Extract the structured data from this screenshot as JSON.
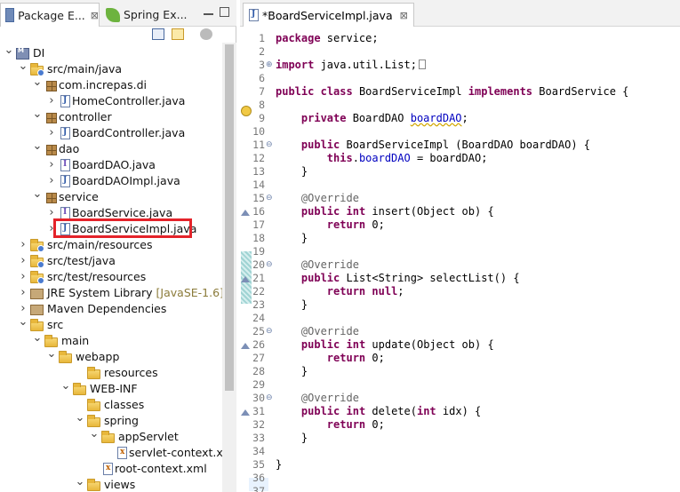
{
  "left_panel": {
    "tabs": [
      {
        "label": "Package E...",
        "close": "⊠",
        "active": true
      },
      {
        "label": "Spring Ex...",
        "close": "⊠",
        "active": false
      }
    ],
    "tree": [
      {
        "label": "DI",
        "icon": "project-icon",
        "arrow": "down"
      },
      {
        "label": "src/main/java",
        "icon": "source-folder-icon",
        "arrow": "down"
      },
      {
        "label": "com.increpas.di",
        "icon": "package-icon",
        "arrow": "down"
      },
      {
        "label": "HomeController.java",
        "icon": "java-file-icon",
        "arrow": "right"
      },
      {
        "label": "controller",
        "icon": "package-icon",
        "arrow": "down"
      },
      {
        "label": "BoardController.java",
        "icon": "java-file-icon",
        "arrow": "right"
      },
      {
        "label": "dao",
        "icon": "package-icon",
        "arrow": "down"
      },
      {
        "label": "BoardDAO.java",
        "icon": "java-interface-icon",
        "arrow": "right"
      },
      {
        "label": "BoardDAOImpl.java",
        "icon": "java-file-icon",
        "arrow": "right"
      },
      {
        "label": "service",
        "icon": "package-icon",
        "arrow": "down"
      },
      {
        "label": "BoardService.java",
        "icon": "java-interface-icon",
        "arrow": "right"
      },
      {
        "label": "BoardServiceImpl.java",
        "icon": "java-file-icon",
        "arrow": "right",
        "highlighted": true
      },
      {
        "label": "src/main/resources",
        "icon": "source-folder-icon",
        "arrow": "right"
      },
      {
        "label": "src/test/java",
        "icon": "source-folder-icon",
        "arrow": "right"
      },
      {
        "label": "src/test/resources",
        "icon": "source-folder-icon",
        "arrow": "right"
      },
      {
        "label": "JRE System Library",
        "decoration": "[JavaSE-1.6]",
        "icon": "library-icon",
        "arrow": "right"
      },
      {
        "label": "Maven Dependencies",
        "icon": "library-icon",
        "arrow": "right"
      },
      {
        "label": "src",
        "icon": "folder-icon",
        "arrow": "down"
      },
      {
        "label": "main",
        "icon": "folder-icon",
        "arrow": "down"
      },
      {
        "label": "webapp",
        "icon": "folder-icon",
        "arrow": "down"
      },
      {
        "label": "resources",
        "icon": "folder-icon",
        "arrow": "none"
      },
      {
        "label": "WEB-INF",
        "icon": "folder-icon",
        "arrow": "down"
      },
      {
        "label": "classes",
        "icon": "folder-icon",
        "arrow": "none"
      },
      {
        "label": "spring",
        "icon": "folder-icon",
        "arrow": "down"
      },
      {
        "label": "appServlet",
        "icon": "folder-icon",
        "arrow": "down"
      },
      {
        "label": "servlet-context.xml",
        "icon": "xml-file-icon",
        "arrow": "none"
      },
      {
        "label": "root-context.xml",
        "icon": "xml-file-icon",
        "arrow": "none"
      },
      {
        "label": "views",
        "icon": "folder-icon",
        "arrow": "down"
      }
    ]
  },
  "editor": {
    "tab_label": "*BoardServiceImpl.java",
    "tab_close": "⊠",
    "line_numbers": [
      "1",
      "2",
      "3",
      "6",
      "7",
      "8",
      "9",
      "10",
      "11",
      "12",
      "13",
      "14",
      "15",
      "16",
      "17",
      "18",
      "19",
      "20",
      "21",
      "22",
      "23",
      "24",
      "25",
      "26",
      "27",
      "28",
      "29",
      "30",
      "31",
      "32",
      "33",
      "34",
      "35",
      "36",
      "37"
    ]
  },
  "colors": {
    "keyword": "#7f0055",
    "annotation": "#646464",
    "field": "#0000c0",
    "highlight_box": "#e4232a"
  }
}
